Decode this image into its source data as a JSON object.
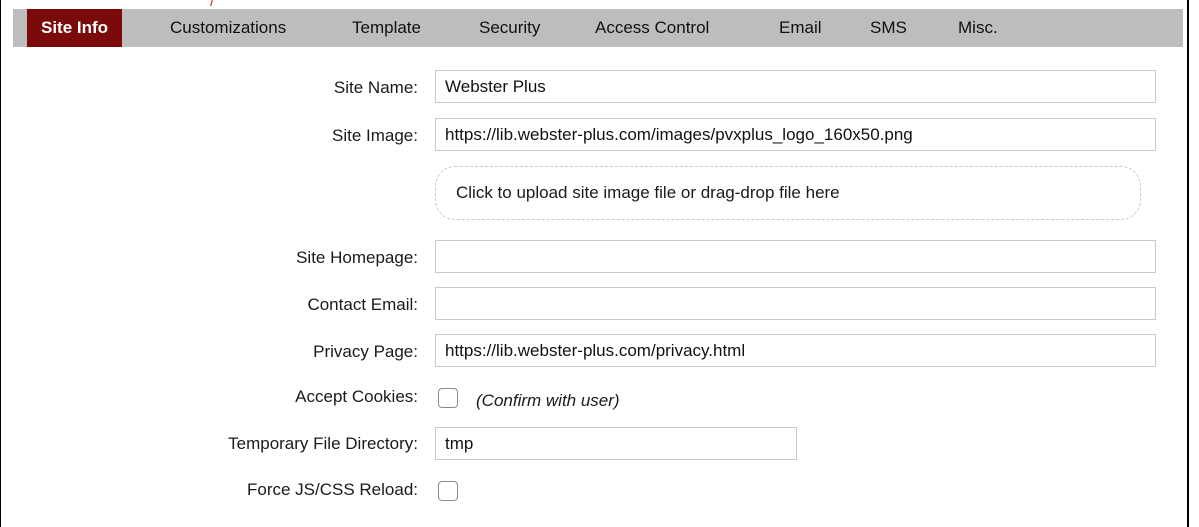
{
  "tabs": [
    {
      "label": "Site Info",
      "active": true
    },
    {
      "label": "Customizations",
      "active": false
    },
    {
      "label": "Template",
      "active": false
    },
    {
      "label": "Security",
      "active": false
    },
    {
      "label": "Access Control",
      "active": false
    },
    {
      "label": "Email",
      "active": false
    },
    {
      "label": "SMS",
      "active": false
    },
    {
      "label": "Misc.",
      "active": false
    }
  ],
  "colors": {
    "tab_bar": "#bdbdbd",
    "active_tab": "#7b0a0a",
    "input_border": "#c9c9c9"
  },
  "form": {
    "site_name": {
      "label": "Site Name:",
      "value": "Webster Plus"
    },
    "site_image": {
      "label": "Site Image:",
      "value": "https://lib.webster-plus.com/images/pvxplus_logo_160x50.png"
    },
    "upload": {
      "text": "Click to upload site image file or drag-drop file here"
    },
    "site_homepage": {
      "label": "Site Homepage:",
      "value": ""
    },
    "contact_email": {
      "label": "Contact Email:",
      "value": ""
    },
    "privacy_page": {
      "label": "Privacy Page:",
      "value": "https://lib.webster-plus.com/privacy.html"
    },
    "accept_cookies": {
      "label": "Accept Cookies:",
      "checked": false,
      "hint": "(Confirm with user)"
    },
    "temp_dir": {
      "label": "Temporary File Directory:",
      "value": "tmp"
    },
    "force_reload": {
      "label": "Force JS/CSS Reload:",
      "checked": false
    }
  }
}
